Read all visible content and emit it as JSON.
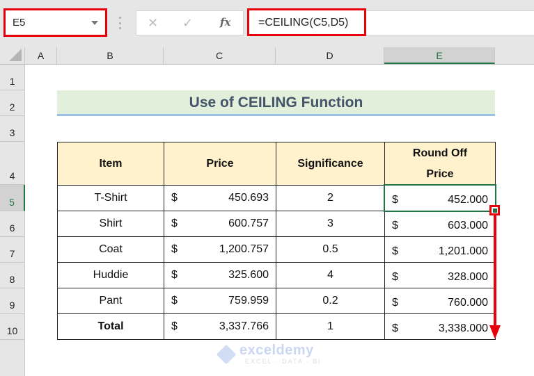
{
  "formula_bar": {
    "name_box": "E5",
    "cancel_icon": "✕",
    "enter_icon": "✓",
    "fx_label": "fx",
    "formula": "=CEILING(C5,D5)"
  },
  "columns": [
    "A",
    "B",
    "C",
    "D",
    "E"
  ],
  "selected_column": "E",
  "rows": [
    "1",
    "2",
    "3",
    "4",
    "5",
    "6",
    "7",
    "8",
    "9",
    "10"
  ],
  "selected_row": "5",
  "sheet_title": "Use of CEILING Function",
  "table": {
    "headers": [
      "Item",
      "Price",
      "Significance",
      "Round Off Price"
    ],
    "rows": [
      {
        "item": "T-Shirt",
        "currency": "$",
        "price": "450.693",
        "significance": "2",
        "round_currency": "$",
        "round_off": "452.000"
      },
      {
        "item": "Shirt",
        "currency": "$",
        "price": "600.757",
        "significance": "3",
        "round_currency": "$",
        "round_off": "603.000"
      },
      {
        "item": "Coat",
        "currency": "$",
        "price": "1,200.757",
        "significance": "0.5",
        "round_currency": "$",
        "round_off": "1,201.000"
      },
      {
        "item": "Huddie",
        "currency": "$",
        "price": "325.600",
        "significance": "4",
        "round_currency": "$",
        "round_off": "328.000"
      },
      {
        "item": "Pant",
        "currency": "$",
        "price": "759.959",
        "significance": "0.2",
        "round_currency": "$",
        "round_off": "760.000"
      },
      {
        "item": "Total",
        "currency": "$",
        "price": "3,337.766",
        "significance": "1",
        "round_currency": "$",
        "round_off": "3,338.000"
      }
    ]
  },
  "watermark": {
    "name": "exceldemy",
    "tagline": "EXCEL · DATA · BI"
  },
  "colors": {
    "highlight_red": "#e8000b",
    "excel_green": "#217346",
    "title_fill": "#e2efda",
    "header_fill": "#fff2cc"
  }
}
